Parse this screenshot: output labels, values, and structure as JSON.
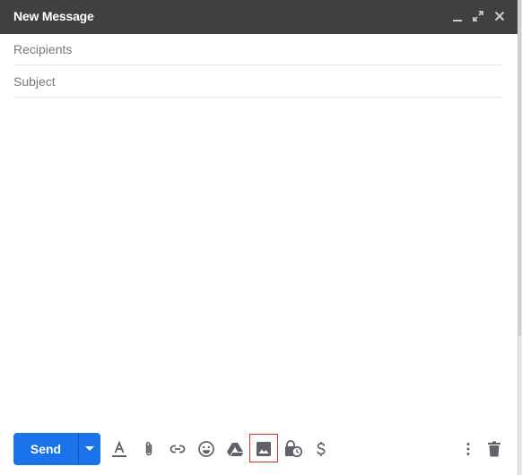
{
  "window": {
    "title": "New Message",
    "controls": [
      {
        "name": "minimize",
        "icon": "minimize-icon"
      },
      {
        "name": "full-screen",
        "icon": "expand-icon"
      },
      {
        "name": "close",
        "icon": "close-icon"
      }
    ]
  },
  "fields": {
    "recipients": {
      "placeholder": "Recipients",
      "value": ""
    },
    "subject": {
      "placeholder": "Subject",
      "value": ""
    },
    "body": {
      "value": ""
    }
  },
  "toolbar": {
    "send_label": "Send",
    "send_options_icon": "caret-down-icon",
    "tools": [
      {
        "name": "formatting-options",
        "icon": "text-format-icon"
      },
      {
        "name": "attach-files",
        "icon": "paperclip-icon"
      },
      {
        "name": "insert-link",
        "icon": "link-icon"
      },
      {
        "name": "insert-emoji",
        "icon": "emoji-icon"
      },
      {
        "name": "insert-files-using-drive",
        "icon": "drive-icon"
      },
      {
        "name": "insert-photo",
        "icon": "photo-icon",
        "selected": true
      },
      {
        "name": "confidential-mode",
        "icon": "lock-clock-icon"
      },
      {
        "name": "send-money",
        "icon": "dollar-icon"
      }
    ],
    "more_options_icon": "more-vert-icon",
    "discard_icon": "trash-icon"
  },
  "colors": {
    "header_bg": "#404040",
    "send_blue": "#1a73e8",
    "icon_gray": "#5f6368",
    "selection_red": "#d93025"
  }
}
